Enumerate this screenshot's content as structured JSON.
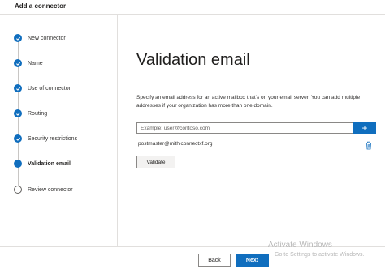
{
  "window": {
    "title": "Add a connector"
  },
  "steps": [
    {
      "label": "New connector",
      "state": "done"
    },
    {
      "label": "Name",
      "state": "done"
    },
    {
      "label": "Use of connector",
      "state": "done"
    },
    {
      "label": "Routing",
      "state": "done"
    },
    {
      "label": "Security restrictions",
      "state": "done"
    },
    {
      "label": "Validation email",
      "state": "current"
    },
    {
      "label": "Review connector",
      "state": "todo"
    }
  ],
  "main": {
    "heading": "Validation email",
    "description": "Specify an email address for an active mailbox that's on your email server. You can add multiple addresses if your organization has more than one domain.",
    "email_input": {
      "placeholder": "Example: user@contoso.com",
      "value": ""
    },
    "add_button_label": "+",
    "emails": [
      "postmaster@mithiconnectxf.org"
    ],
    "validate_label": "Validate"
  },
  "footer": {
    "back_label": "Back",
    "next_label": "Next"
  },
  "watermark": {
    "title": "Activate Windows",
    "subtitle": "Go to Settings to activate Windows."
  },
  "colors": {
    "accent": "#106ebe",
    "border": "#e1dfdd"
  }
}
